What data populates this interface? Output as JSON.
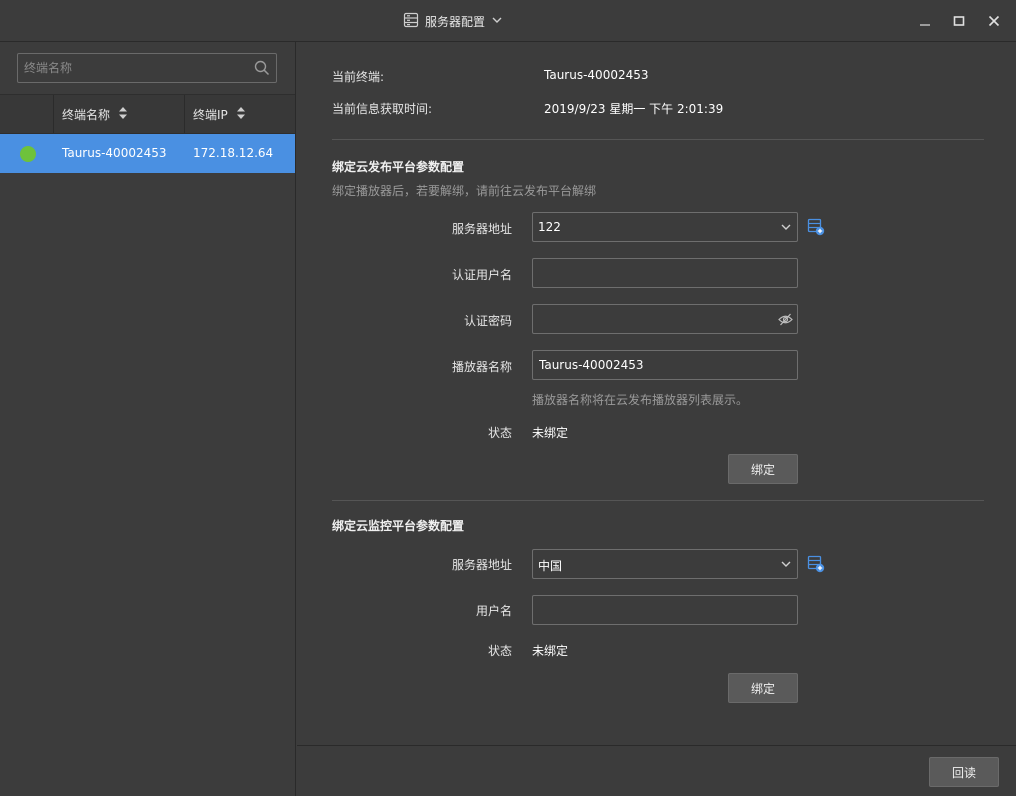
{
  "window": {
    "title": "服务器配置",
    "icon": "server-icon",
    "controls": [
      "minimize-icon",
      "maximize-icon",
      "close-icon"
    ]
  },
  "left": {
    "search_placeholder": "终端名称",
    "columns": [
      "终端名称",
      "终端IP"
    ],
    "rows": [
      {
        "status": "online",
        "status_color": "#6ec23b",
        "name": "Taurus-40002453",
        "ip": "172.18.12.64"
      }
    ],
    "selected_color": "#4a90e2"
  },
  "info": {
    "terminal_label": "当前终端:",
    "terminal_value": "Taurus-40002453",
    "time_label": "当前信息获取时间:",
    "time_value": "2019/9/23 星期一 下午 2:01:39"
  },
  "cloud_publish": {
    "title": "绑定云发布平台参数配置",
    "hint": "绑定播放器后，若要解绑，请前往云发布平台解绑",
    "server_label": "服务器地址",
    "server_value": "122",
    "user_label": "认证用户名",
    "user_value": "",
    "password_label": "认证密码",
    "password_value": "",
    "player_label": "播放器名称",
    "player_value": "Taurus-40002453",
    "player_hint": "播放器名称将在云发布播放器列表展示。",
    "status_label": "状态",
    "status_value": "未绑定",
    "bind_button": "绑定"
  },
  "cloud_monitor": {
    "title": "绑定云监控平台参数配置",
    "server_label": "服务器地址",
    "server_value": "中国",
    "user_label": "用户名",
    "user_value": "",
    "status_label": "状态",
    "status_value": "未绑定",
    "bind_button": "绑定"
  },
  "footer": {
    "readback_button": "回读"
  },
  "accent_color": "#4a90e2"
}
